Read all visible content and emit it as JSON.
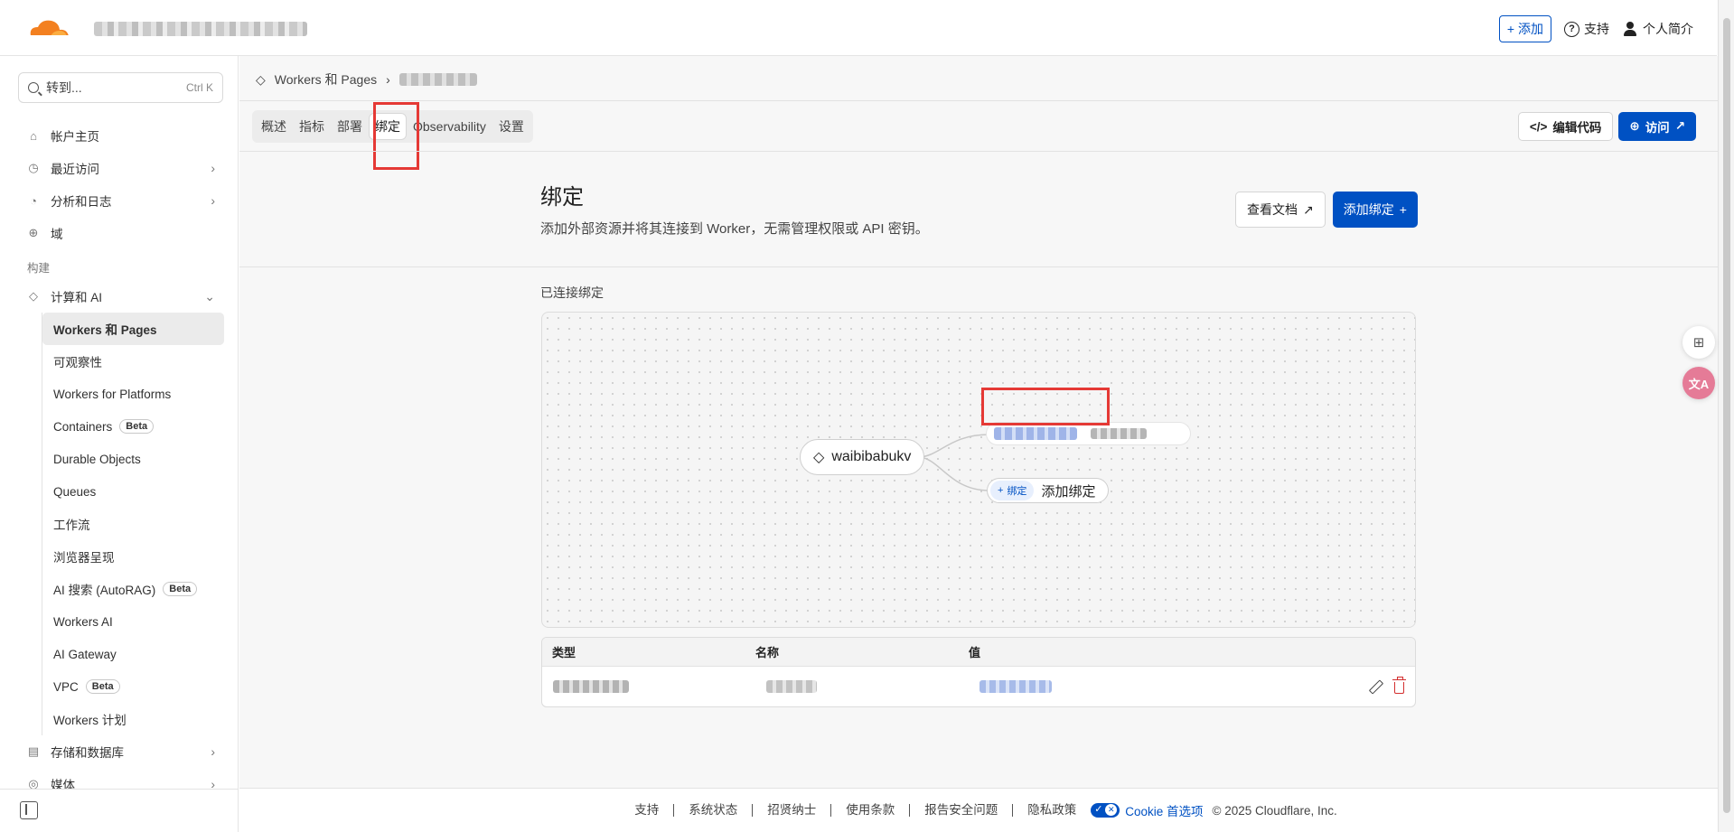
{
  "topbar": {
    "add_label": "添加",
    "support_label": "支持",
    "profile_label": "个人简介"
  },
  "sidebar": {
    "search_placeholder": "转到...",
    "search_shortcut": "Ctrl K",
    "items": [
      {
        "label": "帐户主页",
        "icon": "home-icon"
      },
      {
        "label": "最近访问",
        "icon": "clock-icon"
      },
      {
        "label": "分析和日志",
        "icon": "chart-icon"
      },
      {
        "label": "域",
        "icon": "globe-icon"
      }
    ],
    "section_build": "构建",
    "compute_label": "计算和 AI",
    "sub_items": [
      {
        "label": "Workers 和 Pages"
      },
      {
        "label": "可观察性"
      },
      {
        "label": "Workers for Platforms"
      },
      {
        "label": "Containers",
        "badge": "Beta"
      },
      {
        "label": "Durable Objects"
      },
      {
        "label": "Queues"
      },
      {
        "label": "工作流"
      },
      {
        "label": "浏览器呈现"
      },
      {
        "label": "AI 搜索 (AutoRAG)",
        "badge": "Beta"
      },
      {
        "label": "Workers AI"
      },
      {
        "label": "AI Gateway"
      },
      {
        "label": "VPC",
        "badge": "Beta"
      },
      {
        "label": "Workers 计划"
      }
    ],
    "storage_label": "存储和数据库",
    "media_label": "媒体"
  },
  "main": {
    "breadcrumb_root": "Workers 和 Pages",
    "tabs": [
      "概述",
      "指标",
      "部署",
      "绑定",
      "Observability",
      "设置"
    ],
    "active_tab": "绑定",
    "edit_code_label": "编辑代码",
    "visit_label": "访问",
    "title": "绑定",
    "subtitle": "添加外部资源并将其连接到 Worker，无需管理权限或 API 密钥。",
    "docs_label": "查看文档",
    "add_binding_label": "添加绑定",
    "connected_label": "已连接绑定",
    "worker_name": "waibibabukv",
    "chip_label": "绑定",
    "node_add_label": "添加绑定",
    "table": {
      "headers": [
        "类型",
        "名称",
        "值"
      ]
    }
  },
  "footer": {
    "links": [
      "支持",
      "系统状态",
      "招贤纳士",
      "使用条款",
      "报告安全问题",
      "隐私政策"
    ],
    "cookie_label": "Cookie 首选项",
    "copyright": "© 2025 Cloudflare, Inc."
  },
  "colors": {
    "accent": "#0051c3",
    "highlight": "#e53935",
    "logo_orange": "#f38020"
  }
}
